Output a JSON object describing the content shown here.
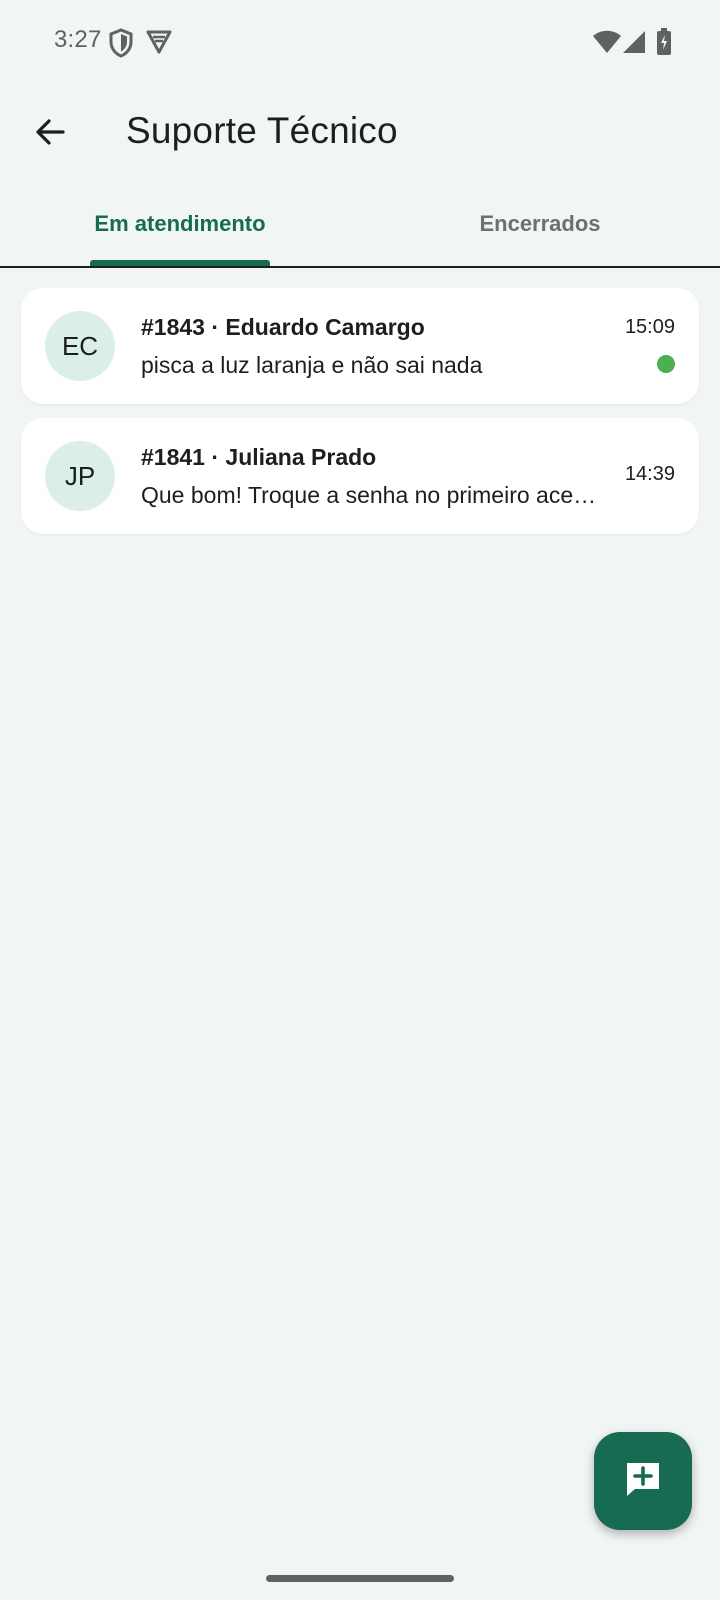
{
  "status_bar": {
    "time": "3:27",
    "left_icons": [
      "shield-icon",
      "vpn-icon"
    ],
    "right_icons": [
      "wifi-icon",
      "signal-icon",
      "battery-charging-icon"
    ]
  },
  "app_bar": {
    "back_icon": "arrow-back-icon",
    "title": "Suporte Técnico"
  },
  "tabs": [
    {
      "label": "Em atendimento",
      "selected": true
    },
    {
      "label": "Encerrados",
      "selected": false
    }
  ],
  "tickets": [
    {
      "initials": "EC",
      "title": "#1843 · Eduardo Camargo",
      "preview": "pisca a luz laranja e não sai nada",
      "time": "15:09",
      "unread": true
    },
    {
      "initials": "JP",
      "title": "#1841 · Juliana Prado",
      "preview": "Que bom! Troque a senha no primeiro acesso.",
      "time": "14:39",
      "unread": false
    }
  ],
  "fab": {
    "icon": "add-chat-icon"
  },
  "colors": {
    "accent": "#176b52",
    "background": "#f1f5f4",
    "avatar_bg": "#dcefe6",
    "unread_dot": "#4caf50"
  }
}
